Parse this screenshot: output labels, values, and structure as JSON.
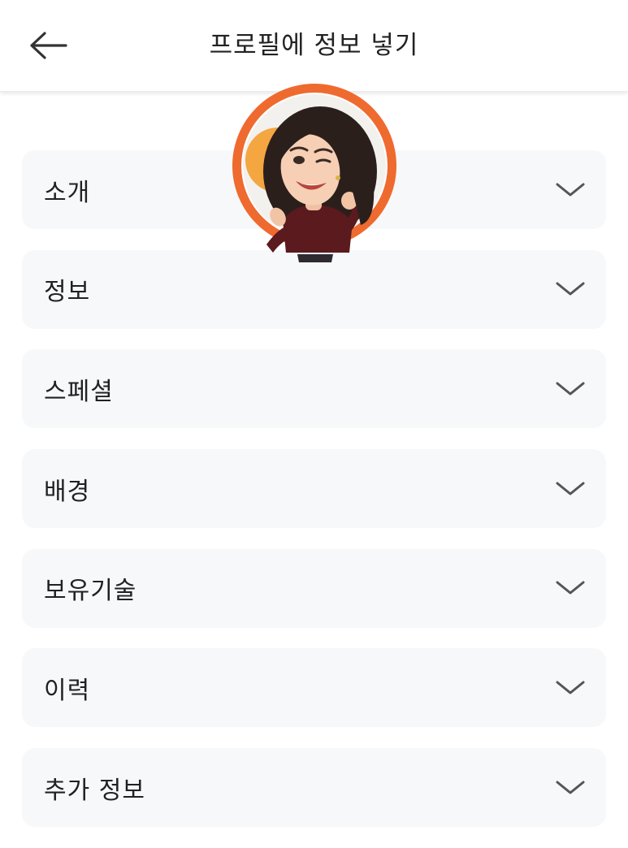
{
  "header": {
    "title": "프로필에 정보 넣기",
    "back_icon": "arrow-left-icon"
  },
  "sections": [
    {
      "label": "소개",
      "icon": "chevron-down-icon"
    },
    {
      "label": "정보",
      "icon": "chevron-down-icon"
    },
    {
      "label": "스페셜",
      "icon": "chevron-down-icon"
    },
    {
      "label": "배경",
      "icon": "chevron-down-icon"
    },
    {
      "label": "보유기술",
      "icon": "chevron-down-icon"
    },
    {
      "label": "이력",
      "icon": "chevron-down-icon"
    },
    {
      "label": "추가 정보",
      "icon": "chevron-down-icon"
    }
  ],
  "colors": {
    "accent_ring": "#ef6a2f",
    "card_background": "#f7f8fa",
    "text": "#202124",
    "chevron": "#555555"
  }
}
